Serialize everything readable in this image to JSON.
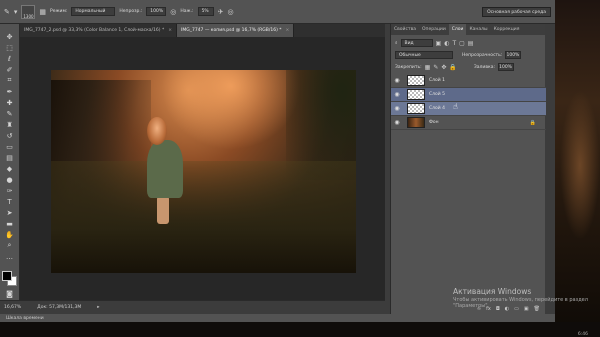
{
  "window": {
    "tabs": [
      {
        "label": "IMG_7747_2.psd @ 33,3% (Color Balance 1, Слой-маска/16) *",
        "active": false
      },
      {
        "label": "IMG_7747 — копия.psd @ 16,7% (RGB/16) *",
        "active": true
      }
    ],
    "close_glyph": "×"
  },
  "optionsbar": {
    "brush_size": "1300",
    "mode_label": "Режим:",
    "mode_value": "Нормальный",
    "opacity_label": "Непрозр.:",
    "opacity_value": "100%",
    "flow_label": "Наж.:",
    "flow_value": "5%",
    "workspace": "Основная рабочая среда"
  },
  "panel": {
    "tabs": [
      "Свойства",
      "Операции",
      "Слои",
      "Каналы",
      "Коррекция"
    ],
    "active_tab": "Слои",
    "filter_value": "Вид",
    "blend_mode": "Обычные",
    "opacity_label": "Непрозрачность:",
    "opacity_value": "100%",
    "lock_label": "Закрепить:",
    "fill_label": "Заливка:",
    "fill_value": "100%",
    "layers": [
      {
        "name": "Слой 1",
        "thumb": "transparent",
        "selected": false
      },
      {
        "name": "Слой 5",
        "thumb": "transparent",
        "selected": true
      },
      {
        "name": "Слой 4",
        "thumb": "transparent",
        "selected": true
      },
      {
        "name": "Фон",
        "thumb": "photo",
        "selected": false,
        "locked": true
      }
    ]
  },
  "statusbar": {
    "zoom": "16,67%",
    "doc": "Док: 57,3M/131,3M"
  },
  "timeline": {
    "label": "Шкала времени"
  },
  "activation": {
    "title": "Активация Windows",
    "subtitle": "Чтобы активировать Windows, перейдите в раздел \"Параметры\"."
  },
  "clock": "6:46"
}
